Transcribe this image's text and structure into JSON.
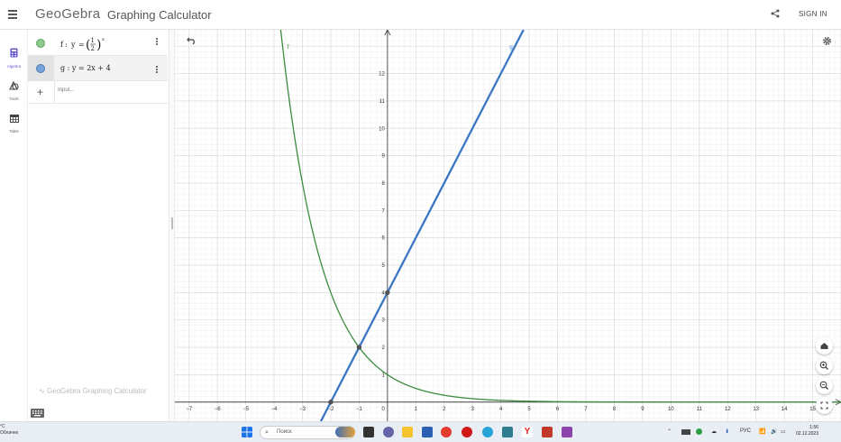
{
  "header": {
    "logo": "GeoGebra",
    "app_title": "Graphing Calculator",
    "signin_label": "SIGN IN"
  },
  "leftnav": [
    {
      "label": "Algebra",
      "icon": "calculator-icon",
      "active": true
    },
    {
      "label": "Tools",
      "icon": "shapes-icon",
      "active": false
    },
    {
      "label": "Table",
      "icon": "table-icon",
      "active": false
    }
  ],
  "algebra": {
    "f_name": "f",
    "g_expr": "g : y = 2x + 4",
    "f_color": "#8cc98c",
    "g_color": "#7aa4d9",
    "input_placeholder": "Input...",
    "watermark": "GeoGebra Graphing Calculator"
  },
  "graph": {
    "xlim": [
      -7.5,
      16
    ],
    "ylim": [
      -0.7,
      13.6
    ],
    "x_ticks": [
      -7,
      -6,
      -5,
      -4,
      -3,
      -2,
      -1,
      1,
      2,
      3,
      4,
      5,
      6,
      7,
      8,
      9,
      10,
      11,
      12,
      13,
      14,
      15
    ],
    "y_ticks": [
      1,
      2,
      3,
      4,
      5,
      6,
      7,
      8,
      9,
      10,
      11,
      12
    ],
    "f_label": "f",
    "g_label": "g",
    "f_color": "#3d8c3d",
    "g_color": "#4a86d4",
    "points": [
      {
        "x": -2,
        "y": 0
      },
      {
        "x": 0,
        "y": 4
      },
      {
        "x": -1,
        "y": 2
      }
    ]
  },
  "taskbar": {
    "weather_temp": "°C",
    "weather_text": "Облачно",
    "search_placeholder": "Поиск",
    "lang": "РУС",
    "time": "1:56",
    "date": "02.12.2023"
  }
}
